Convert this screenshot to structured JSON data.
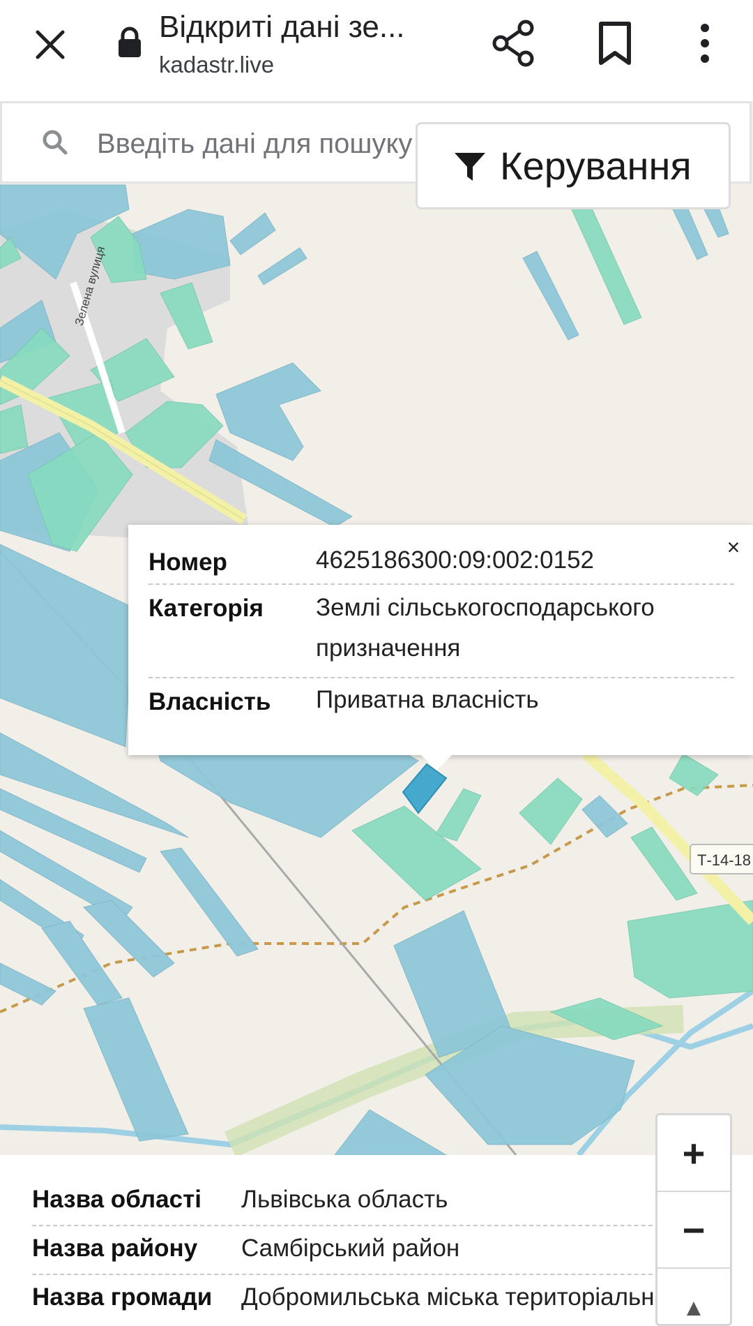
{
  "browser": {
    "title": "Відкриті дані зе...",
    "url": "kadastr.live",
    "icons": [
      "close-icon",
      "lock-icon",
      "share-icon",
      "bookmark-icon",
      "more-vert-icon"
    ]
  },
  "search": {
    "placeholder": "Введіть дані для пошуку"
  },
  "control_button": {
    "label": "Керування",
    "icon": "filter-icon"
  },
  "map": {
    "street_label": "Зелена вулиця",
    "road_label": "Т-14-18",
    "colors": {
      "background": "#f2efe9",
      "parcel_blue": "#8ec7d8",
      "parcel_green": "#86dbbf",
      "road": "#f3f1a8",
      "selected": "#45a8cc"
    }
  },
  "popup": {
    "close": "×",
    "rows": [
      {
        "key": "Номер",
        "value": "4625186300:09:002:0152"
      },
      {
        "key": "Категорія",
        "value": "Землі сільськогосподарського призначення"
      },
      {
        "key": "Власність",
        "value": "Приватна власність"
      }
    ]
  },
  "info": {
    "rows": [
      {
        "key": "Назва області",
        "value": "Львівська область"
      },
      {
        "key": "Назва району",
        "value": "Самбірський район"
      },
      {
        "key": "Назва громади",
        "value": "Добромильська міська територіальна"
      }
    ]
  },
  "zoom": {
    "in": "+",
    "out": "−",
    "north": "▲"
  }
}
